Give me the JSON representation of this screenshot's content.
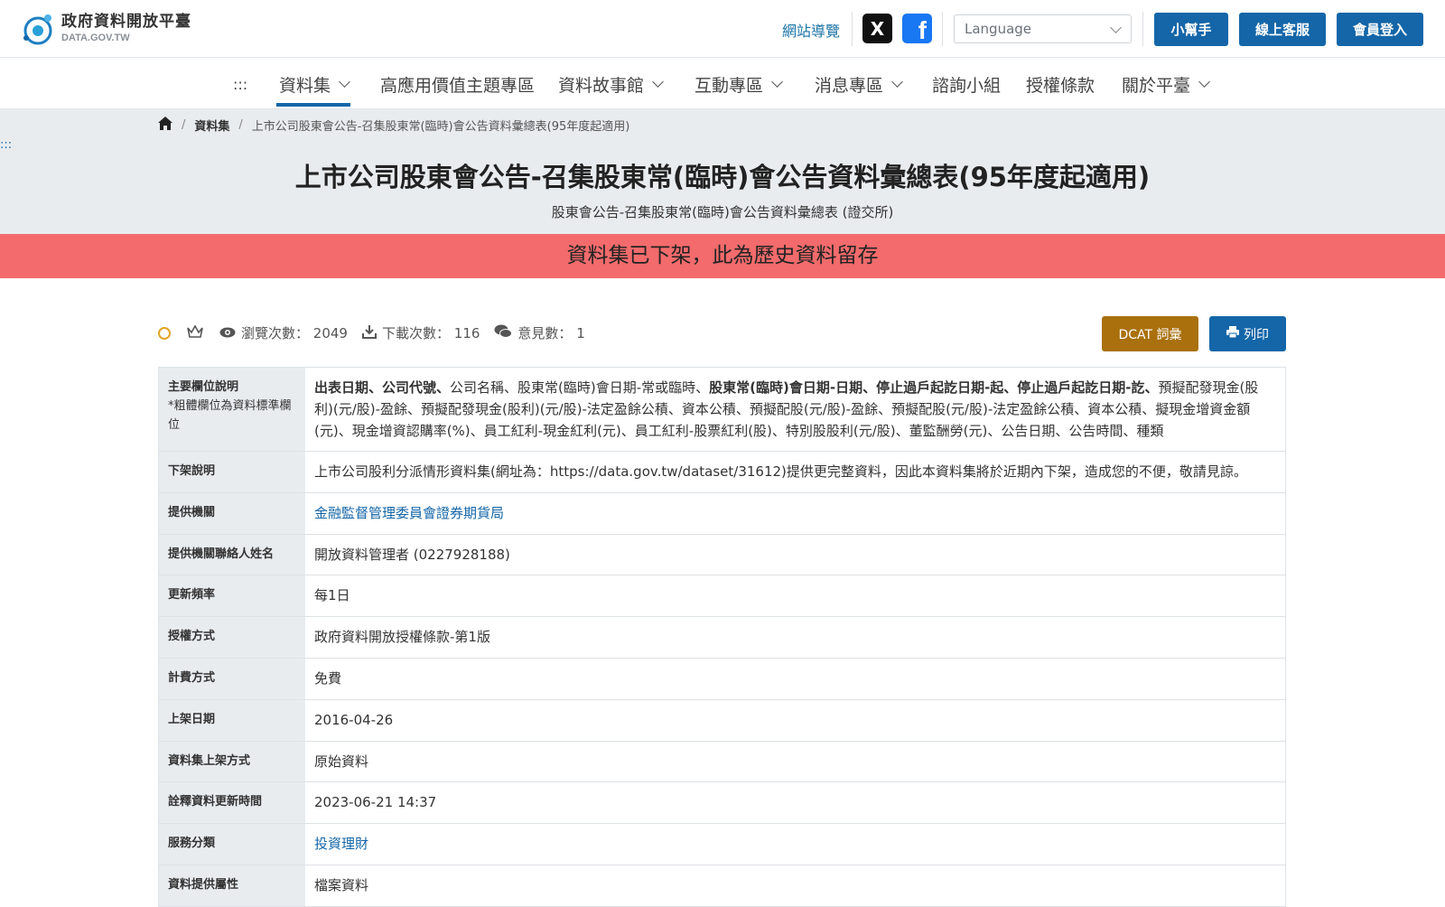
{
  "header": {
    "logo_zh": "政府資料開放平臺",
    "logo_en": "DATA.GOV.TW",
    "sitemap": "網站導覽",
    "social_x": "X",
    "social_fb": "f",
    "language_placeholder": "Language",
    "helper": "小幫手",
    "online_service": "線上客服",
    "member_login": "會員登入"
  },
  "nav": {
    "dots": ":::",
    "items": [
      "資料集",
      "高應用價值主題專區",
      "資料故事館",
      "互動專區",
      "消息專區",
      "諮詢小組",
      "授權條款",
      "關於平臺"
    ]
  },
  "breadcrumb": {
    "home_icon": "home-icon",
    "level1": "資料集",
    "current": "上市公司股東會公告-召集股東常(臨時)會公告資料彙總表(95年度起適用)"
  },
  "hero": {
    "dots": ":::",
    "title": "上市公司股東會公告-召集股東常(臨時)會公告資料彙總表(95年度起適用)",
    "subtitle": "股東會公告-召集股東常(臨時)會公告資料彙總表 (證交所)"
  },
  "alert": "資料集已下架，此為歷史資料留存",
  "stats": {
    "views_label": "瀏覽次數：",
    "views": "2049",
    "downloads_label": "下載次數：",
    "downloads": "116",
    "comments_label": "意見數：",
    "comments": "1"
  },
  "buttons": {
    "dcat": "DCAT 詞彙",
    "print": "列印"
  },
  "colors": {
    "primary": "#1466a8",
    "alert": "#f36b6c",
    "dcat": "#a9700d",
    "hero_bg": "#e9ecef"
  },
  "info": {
    "fields_label": "主要欄位說明",
    "fields_note": "*粗體欄位為資料標準欄位",
    "fields_bold1": "出表日期、公司代號、",
    "fields_plain1": "公司名稱、股東常(臨時)會日期-常或臨時、",
    "fields_bold2": "股東常(臨時)會日期-日期、停止過戶起訖日期-起、停止過戶起訖日期-訖、",
    "fields_plain2": "預擬配發現金(股利)(元/股)-盈餘、預擬配發現金(股利)(元/股)-法定盈餘公積、資本公積、預擬配股(元/股)-盈餘、預擬配股(元/股)-法定盈餘公積、資本公積、擬現金增資金額(元)、現金增資認購率(%)、員工紅利-現金紅利(元)、員工紅利-股票紅利(股)、特別股股利(元/股)、董監酬勞(元)、公告日期、公告時間、種類",
    "delist_label": "下架說明",
    "delist_value": "上市公司股利分派情形資料集(網址為：https://data.gov.tw/dataset/31612)提供更完整資料，因此本資料集將於近期內下架，造成您的不便，敬請見諒。",
    "provider_label": "提供機關",
    "provider_value": "金融監督管理委員會證券期貨局",
    "contact_label": "提供機關聯絡人姓名",
    "contact_value": "開放資料管理者 (0227928188)",
    "frequency_label": "更新頻率",
    "frequency_value": "每1日",
    "license_label": "授權方式",
    "license_value": "政府資料開放授權條款-第1版",
    "fee_label": "計費方式",
    "fee_value": "免費",
    "publish_label": "上架日期",
    "publish_value": "2016-04-26",
    "method_label": "資料集上架方式",
    "method_value": "原始資料",
    "meta_update_label": "詮釋資料更新時間",
    "meta_update_value": "2023-06-21 14:37",
    "category_label": "服務分類",
    "category_value": "投資理財",
    "attr_label": "資料提供屬性",
    "attr_value": "檔案資料"
  }
}
